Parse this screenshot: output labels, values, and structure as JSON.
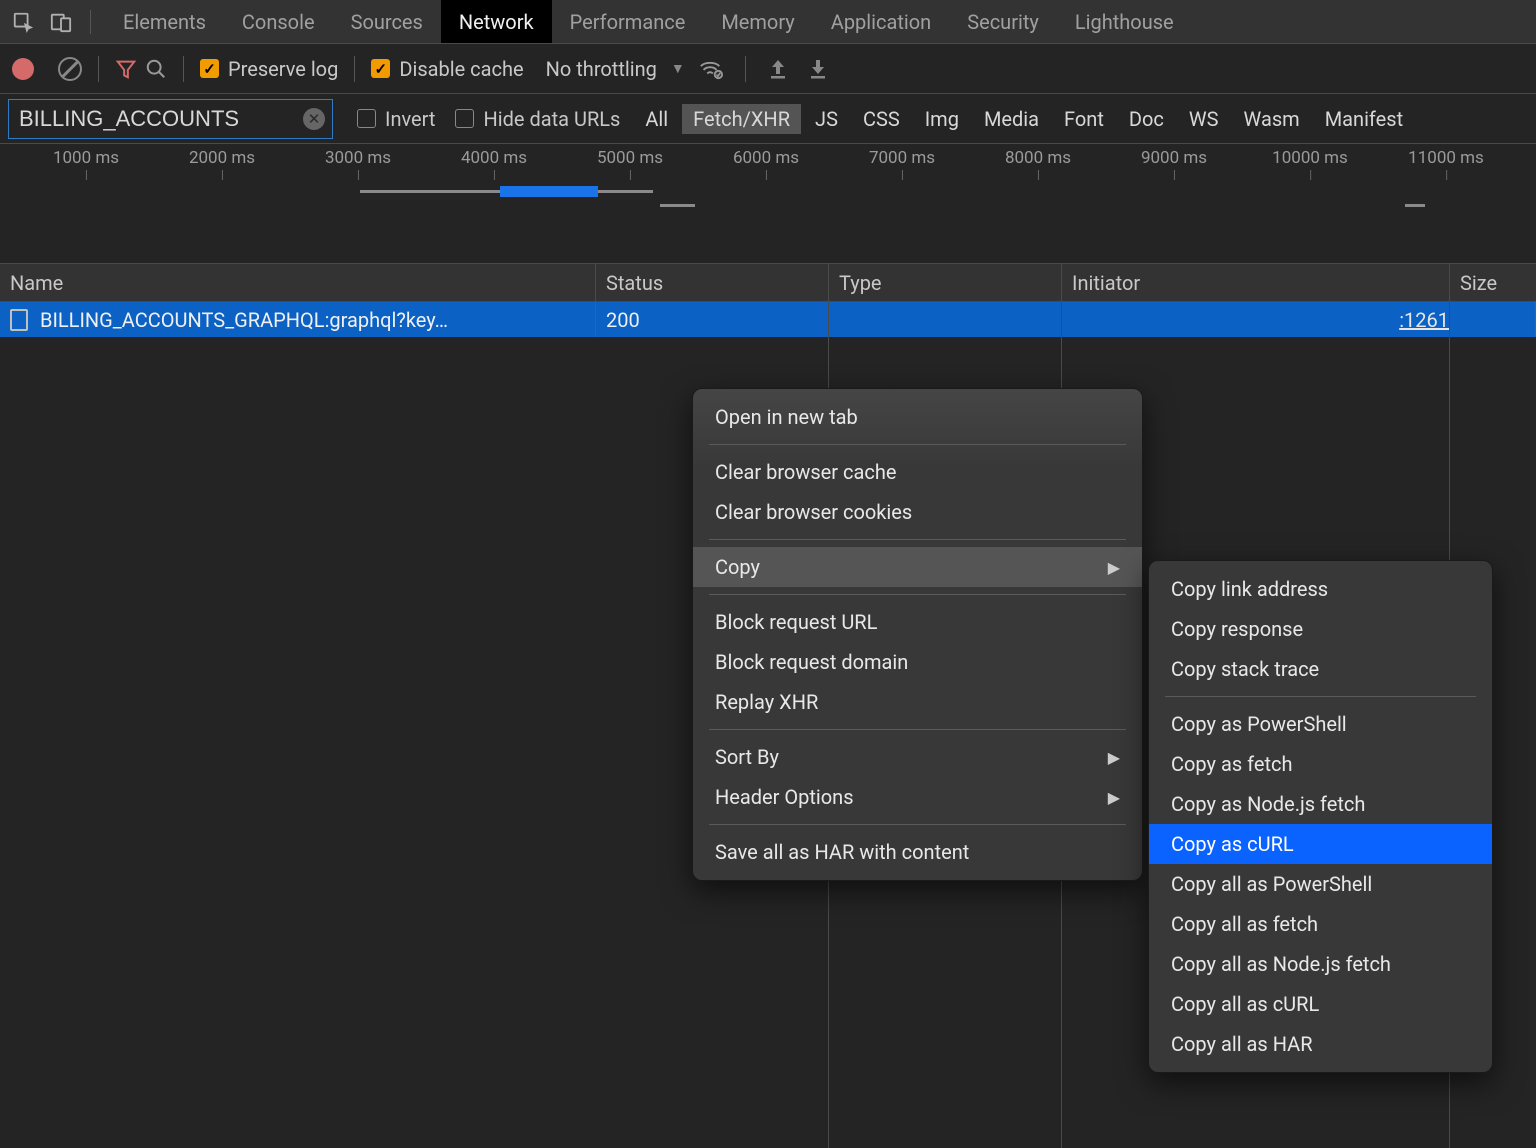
{
  "tabs": {
    "elements": "Elements",
    "console": "Console",
    "sources": "Sources",
    "network": "Network",
    "performance": "Performance",
    "memory": "Memory",
    "application": "Application",
    "security": "Security",
    "lighthouse": "Lighthouse"
  },
  "toolbar": {
    "preserve_log": "Preserve log",
    "disable_cache": "Disable cache",
    "throttling": "No throttling"
  },
  "filter": {
    "value": "BILLING_ACCOUNTS",
    "invert": "Invert",
    "hide_data_urls": "Hide data URLs",
    "types": {
      "all": "All",
      "fetch_xhr": "Fetch/XHR",
      "js": "JS",
      "css": "CSS",
      "img": "Img",
      "media": "Media",
      "font": "Font",
      "doc": "Doc",
      "ws": "WS",
      "wasm": "Wasm",
      "manifest": "Manifest"
    }
  },
  "timeline": {
    "ticks": [
      "1000 ms",
      "2000 ms",
      "3000 ms",
      "4000 ms",
      "5000 ms",
      "6000 ms",
      "7000 ms",
      "8000 ms",
      "9000 ms",
      "10000 ms",
      "11000 ms"
    ]
  },
  "grid": {
    "headers": {
      "name": "Name",
      "status": "Status",
      "type": "Type",
      "initiator": "Initiator",
      "size": "Size"
    },
    "rows": [
      {
        "name": "BILLING_ACCOUNTS_GRAPHQL:graphql?key…",
        "status": "200",
        "type": "",
        "initiator": ":1261",
        "size": ""
      }
    ]
  },
  "menu1": {
    "open_new_tab": "Open in new tab",
    "clear_cache": "Clear browser cache",
    "clear_cookies": "Clear browser cookies",
    "copy": "Copy",
    "block_url": "Block request URL",
    "block_domain": "Block request domain",
    "replay_xhr": "Replay XHR",
    "sort_by": "Sort By",
    "header_options": "Header Options",
    "save_har": "Save all as HAR with content"
  },
  "menu2": {
    "copy_link": "Copy link address",
    "copy_response": "Copy response",
    "copy_stack": "Copy stack trace",
    "copy_ps": "Copy as PowerShell",
    "copy_fetch": "Copy as fetch",
    "copy_node_fetch": "Copy as Node.js fetch",
    "copy_curl": "Copy as cURL",
    "copy_all_ps": "Copy all as PowerShell",
    "copy_all_fetch": "Copy all as fetch",
    "copy_all_node": "Copy all as Node.js fetch",
    "copy_all_curl": "Copy all as cURL",
    "copy_all_har": "Copy all as HAR"
  }
}
